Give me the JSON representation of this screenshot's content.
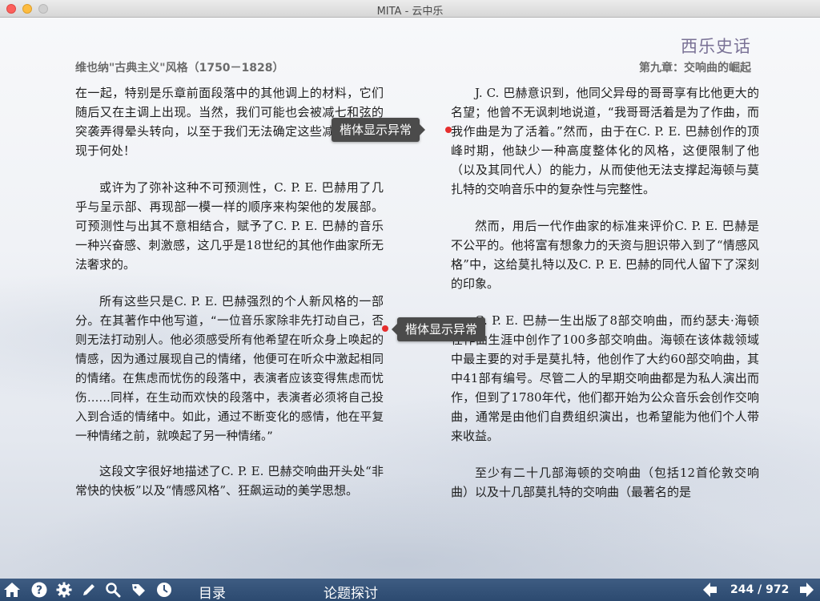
{
  "window": {
    "title": "MITA - 云中乐"
  },
  "book": {
    "title": "西乐史话",
    "header_left": "维也纳\"古典主义\"风格（1750－1828）",
    "header_right": "第九章：交响曲的崛起"
  },
  "left_column": {
    "p1": "在一起，特别是乐章前面段落中的其他调上的材料，它们随后又在主调上出现。当然，我们可能也会被减七和弦的突袭弄得晕头转向，以至于我们无法确定这些减七和弦出现于何处！",
    "p2": "或许为了弥补这种不可预测性，C. P. E. 巴赫用了几乎与呈示部、再现部一模一样的顺序来构架他的发展部。可预测性与出其不意相结合，赋予了C. P. E. 巴赫的音乐一种兴奋感、刺激感，这几乎是18世纪的其他作曲家所无法奢求的。",
    "p3_intro": "所有这些只是C. P. E. 巴赫强烈的个人新风格的一部分。在其著作中他写道，",
    "p3_quote": "“一位音乐家除非先打动自己，否则无法打动别人。他必须感受所有他希望在听众身上唤起的情感，因为通过展现自己的情绪，他便可在听众中激起相同的情绪。在焦虑而忧伤的段落中，表演者应该变得焦虑而忧伤……同样，在生动而欢快的段落中，表演者必须将自己投入到合适的情绪中。如此，通过不断变化的感情，他在平复一种情绪之前，就唤起了另一种情绪。”",
    "p4": "这段文字很好地描述了C. P. E. 巴赫交响曲开头处“非常快的快板”以及“情感风格”、狂飙运动的美学思想。"
  },
  "right_column": {
    "p1_a": "J. C. 巴赫意识到，他同父异母的哥哥享有比他更大的名望；他曾不无讽刺地说道，",
    "p1_quote": "“我哥哥活着是为了作曲，而我作曲是为了活着。”",
    "p1_b": "然而，由于在C. P. E. 巴赫创作的顶峰时期，他缺少一种高度整体化的风格，这便限制了他（以及其同代人）的能力，从而使他无法支撑起海顿与莫扎特的交响音乐中的复杂性与完整性。",
    "p2": "然而，用后一代作曲家的标准来评价C. P. E. 巴赫是不公平的。他将富有想象力的天资与胆识带入到了“情感风格”中，这给莫扎特以及C. P. E. 巴赫的同代人留下了深刻的印象。",
    "p3": "C. P. E. 巴赫一生出版了8部交响曲，而约瑟夫·海顿在作曲生涯中创作了100多部交响曲。海顿在该体裁领域中最主要的对手是莫扎特，他创作了大约60部交响曲，其中41部有编号。尽管二人的早期交响曲都是为私人演出而作，但到了1780年代，他们都开始为公众音乐会创作交响曲，通常是由他们自费组织演出，也希望能为他们个人带来收益。",
    "p4": "至少有二十几部海顿的交响曲（包括12首伦敦交响曲）以及十几部莫扎特的交响曲（最著名的是"
  },
  "tooltips": {
    "tip1": "楷体显示异常",
    "tip2": "楷体显示异常"
  },
  "toolbar": {
    "icons": [
      "home-icon",
      "help-icon",
      "gear-icon",
      "pencil-icon",
      "search-icon",
      "bookmark-icon",
      "clock-icon"
    ],
    "toc_label": "目录",
    "discussion_label": "论题探讨",
    "page_indicator": "244 / 972",
    "colors": {
      "bar": "#34527a",
      "icon": "#ffffff"
    }
  }
}
